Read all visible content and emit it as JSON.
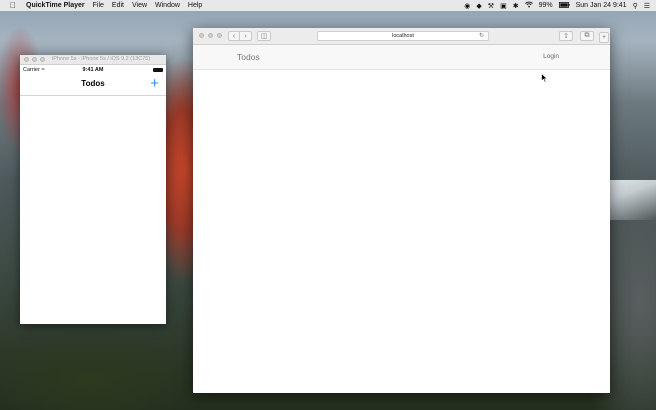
{
  "menubar": {
    "app_name": "QuickTime Player",
    "items": [
      "File",
      "Edit",
      "View",
      "Window",
      "Help"
    ],
    "battery": "99%",
    "datetime": "Sun Jan 24  9:41"
  },
  "simulator": {
    "window_title": "iPhone 5s - iPhone 5s / iOS 9.2 (13C75)",
    "status": {
      "carrier": "Carrier",
      "time": "9:41 AM"
    },
    "nav_title": "Todos",
    "add_label": "+"
  },
  "safari": {
    "url": "localhost",
    "page": {
      "brand": "Todos",
      "login": "Login"
    }
  },
  "colors": {
    "ios_tint": "#2e8ee8"
  }
}
